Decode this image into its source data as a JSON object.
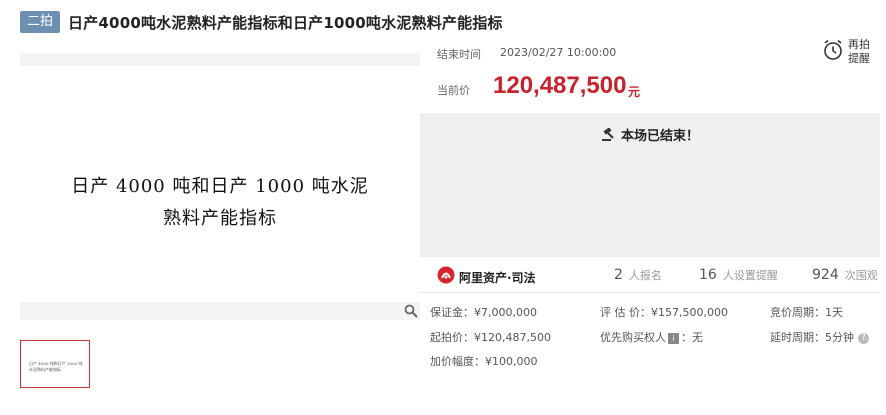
{
  "header": {
    "badge": "二拍",
    "title": "日产4000吨水泥熟料产能指标和日产1000吨水泥熟料产能指标"
  },
  "image": {
    "line1": "日产 4000 吨和日产 1000 吨水泥",
    "line2": "熟料产能指标"
  },
  "thumbnail": {
    "text": "日产 4000 吨和日产 1000 吨水泥熟料产能指标"
  },
  "auction": {
    "end_time_label": "结束时间",
    "end_time_value": "2023/02/27 10:00:00",
    "remind_line1": "再拍",
    "remind_line2": "提醒",
    "price_label": "当前价",
    "price_value": "120,487,500",
    "price_unit": "元",
    "ended_text": "本场已结束！"
  },
  "brand": {
    "name": "阿里资产·司法"
  },
  "stats": {
    "signup_count": "2",
    "signup_label": "人报名",
    "remind_count": "16",
    "remind_label": "人设置提醒",
    "views_count": "924",
    "views_label": "次围观"
  },
  "info": {
    "deposit": "保证金：¥7,000,000",
    "start_price": "起拍价：¥120,487,500",
    "increment": "加价幅度：¥100,000",
    "appraisal": "评 估 价：¥157,500,000",
    "priority_label": "优先购买权人",
    "priority_value": "：无",
    "cycle": "竞价周期：1天",
    "extension": "延时周期：5分钟"
  },
  "colors": {
    "accent_red": "#c8222c",
    "badge_blue": "#6d8fb1"
  }
}
